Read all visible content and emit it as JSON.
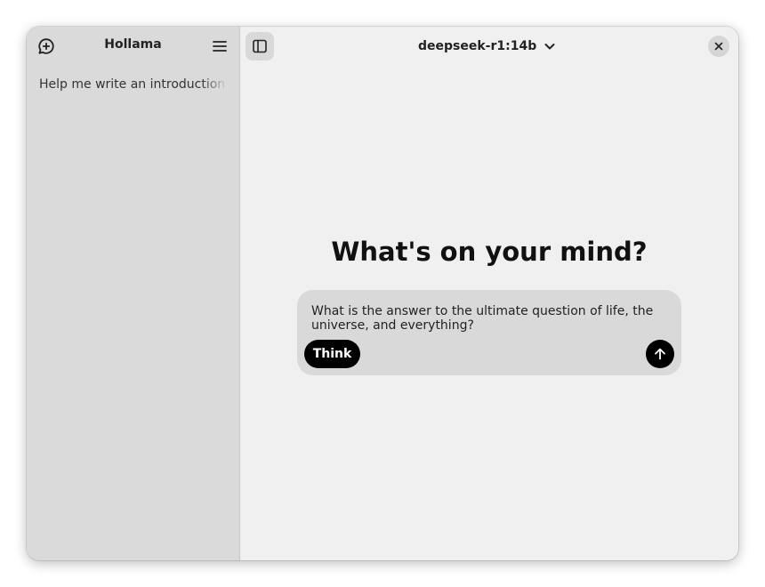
{
  "sidebar": {
    "title": "Hollama",
    "new_chat_icon": "message-plus-icon",
    "menu_icon": "hamburger-menu-icon",
    "chats": [
      {
        "title": "Help me write an introduction for"
      }
    ]
  },
  "header": {
    "sidebar_toggle_icon": "sidebar-panel-icon",
    "model": "deepseek-r1:14b",
    "model_dropdown_icon": "chevron-down-icon",
    "close_icon": "close-icon"
  },
  "main": {
    "headline": "What's on your mind?",
    "prompt": "What is the answer to the ultimate question of life, the universe, and everything?",
    "think_label": "Think",
    "send_icon": "arrow-up-icon"
  },
  "colors": {
    "sidebar_bg": "#dadada",
    "main_bg": "#f0f0f0",
    "composer_bg": "#d9d9d9",
    "button_dark": "#000000"
  }
}
